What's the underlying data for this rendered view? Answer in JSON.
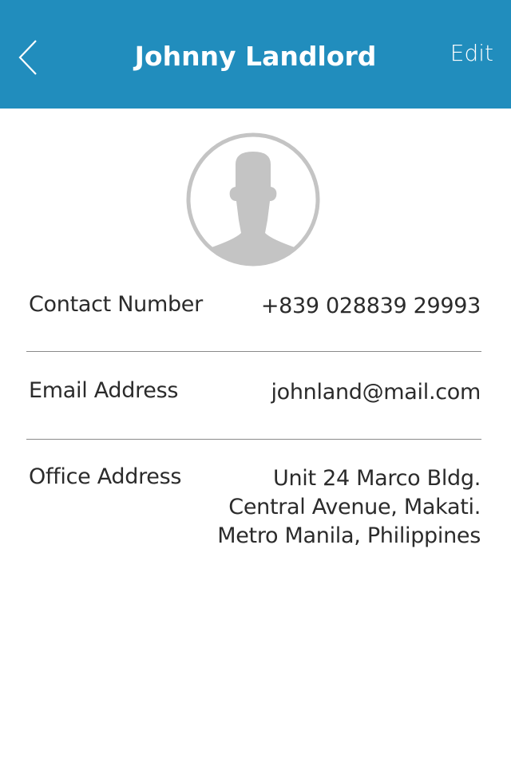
{
  "header": {
    "title": "Johnny Landlord",
    "edit_label": "Edit",
    "back_icon": "chevron-left-icon",
    "background_color": "#218dbd"
  },
  "profile": {
    "avatar_icon": "person-silhouette-icon"
  },
  "details": {
    "contact": {
      "label": "Contact Number",
      "value": "+839 028839 29993"
    },
    "email": {
      "label": "Email Address",
      "value": "johnland@mail.com"
    },
    "office": {
      "label": "Office Address",
      "lines": [
        "Unit 24 Marco Bldg.",
        "Central Avenue, Makati.",
        "Metro Manila, Philippines"
      ]
    }
  }
}
